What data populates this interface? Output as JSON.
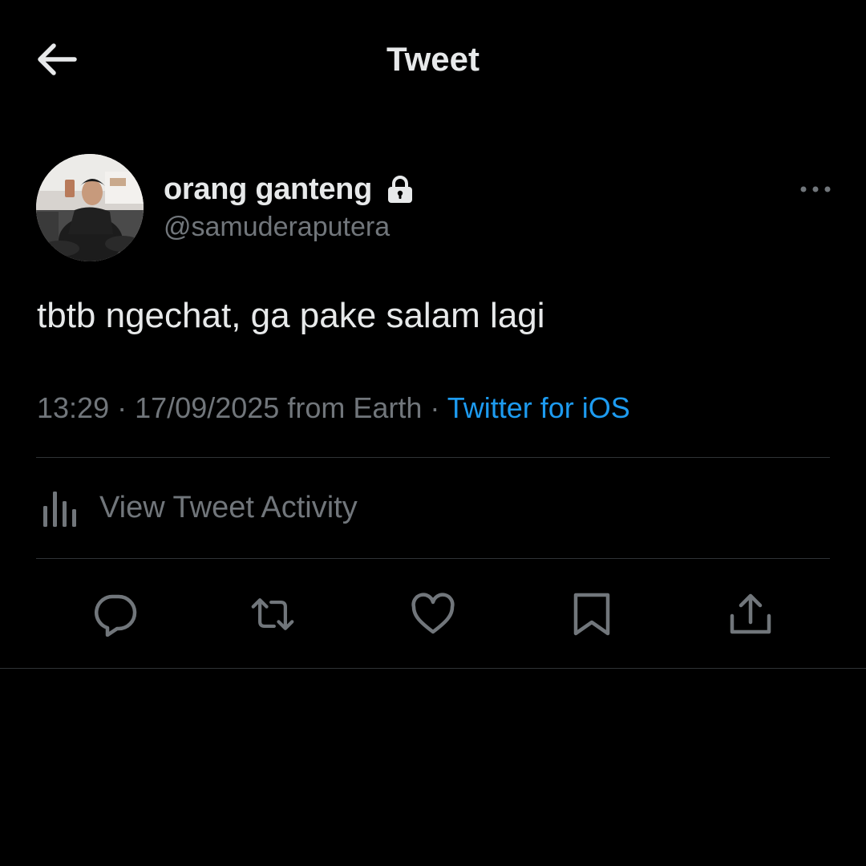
{
  "header": {
    "title": "Tweet",
    "back_icon": "arrow-left-icon"
  },
  "author": {
    "display_name": "orang ganteng",
    "handle": "@samuderaputera",
    "protected_icon": "lock-icon",
    "more_icon": "more-horizontal-icon"
  },
  "tweet": {
    "text": "tbtb ngechat, ga pake salam lagi",
    "time": "13:29",
    "separator": "·",
    "date": "17/09/2025",
    "location": "from Earth",
    "source": "Twitter for iOS"
  },
  "activity": {
    "label": "View Tweet Activity",
    "icon": "bar-chart-icon"
  },
  "actions": [
    {
      "icon": "reply-icon"
    },
    {
      "icon": "retweet-icon"
    },
    {
      "icon": "like-icon"
    },
    {
      "icon": "bookmark-icon"
    },
    {
      "icon": "share-icon"
    }
  ],
  "colors": {
    "background": "#000000",
    "text_primary": "#e7e9ea",
    "text_secondary": "#71767b",
    "link": "#1d9bf0",
    "divider": "#2f3336"
  }
}
